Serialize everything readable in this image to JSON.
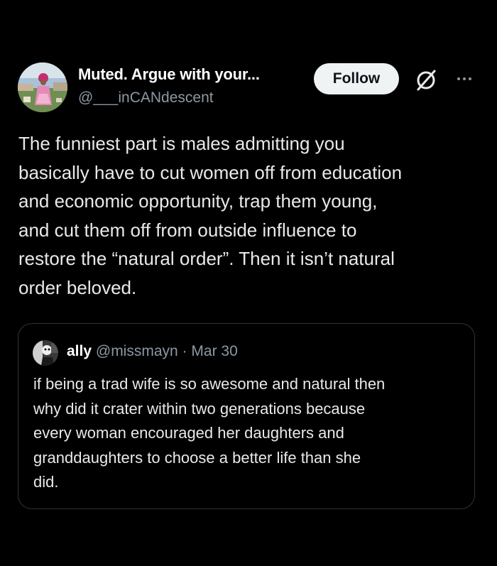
{
  "author": {
    "display_name": "Muted. Argue with your...",
    "handle": "@___inCANdescent"
  },
  "follow_button": {
    "label": "Follow"
  },
  "icons": {
    "grok": "grok-icon",
    "more": "more-options-icon"
  },
  "tweet": {
    "lines": [
      "The funniest part is males admitting you",
      "basically have to cut women off from education",
      "and economic opportunity, trap them young,",
      "and cut them off from outside influence to",
      "restore the “natural order”. Then it isn’t natural",
      "order beloved."
    ]
  },
  "quote": {
    "name": "ally",
    "handle": "@missmayn",
    "separator": "·",
    "date": "Mar 30",
    "lines": [
      "if being a trad wife is so awesome and natural then",
      "why did it crater within two generations because",
      "every woman encouraged her daughters and",
      "granddaughters to choose a better life than she",
      "did."
    ]
  },
  "colors": {
    "background": "#000000",
    "primary_text": "#e7e9ea",
    "secondary_text": "#8b98a5",
    "button_bg": "#eff3f4",
    "border": "#2f3336"
  }
}
